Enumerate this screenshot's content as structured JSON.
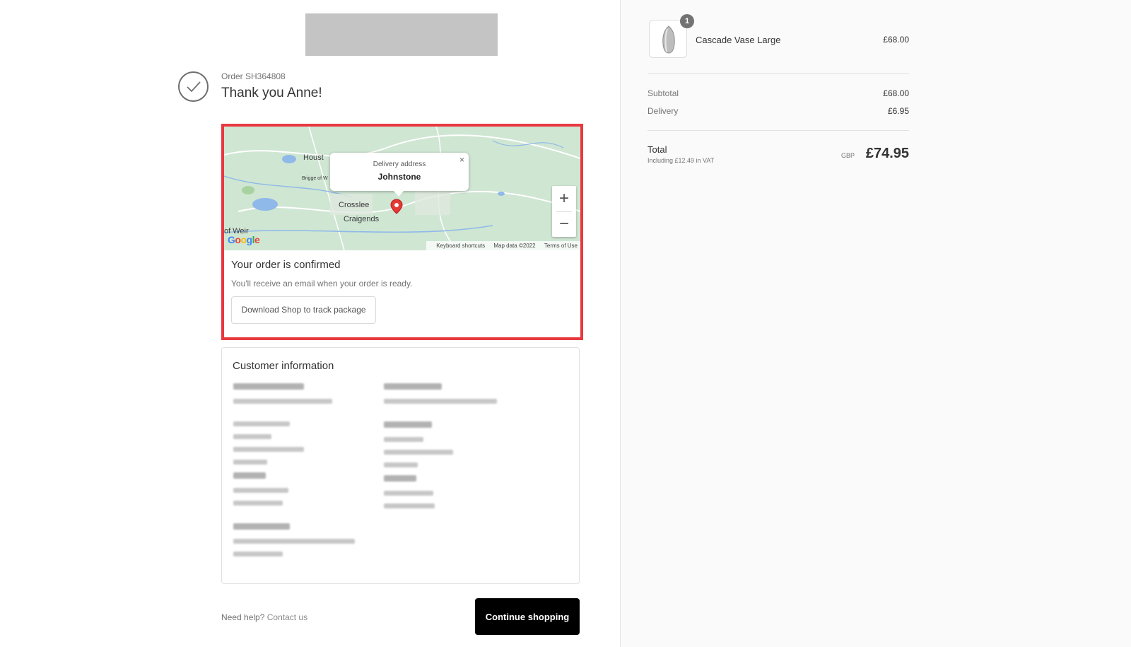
{
  "header": {
    "logo": "store-logo-placeholder"
  },
  "order": {
    "number": "Order SH364808",
    "thank_you": "Thank you Anne!"
  },
  "map": {
    "labels": {
      "houston": "Houst",
      "bridge": "Brigge of W",
      "crosslee": "Crosslee",
      "craigends": "Craigends",
      "weir": "of Weir"
    },
    "popup_title": "Delivery address",
    "popup_city": "Johnstone",
    "popup_close": "×",
    "zoom_in": "+",
    "zoom_out": "−",
    "google": "Google",
    "footer": {
      "shortcuts": "Keyboard shortcuts",
      "map_data": "Map data ©2022",
      "terms": "Terms of Use"
    }
  },
  "confirmation": {
    "title": "Your order is confirmed",
    "text": "You'll receive an email when your order is ready.",
    "download_button": "Download Shop to track package"
  },
  "customer": {
    "title": "Customer information"
  },
  "footer": {
    "need_help": "Need help?",
    "contact": "Contact us",
    "continue_button": "Continue shopping"
  },
  "summary": {
    "product": {
      "name": "Cascade Vase Large",
      "price": "£68.00",
      "quantity": "1",
      "icon": "vase-icon"
    },
    "subtotal_label": "Subtotal",
    "subtotal_value": "£68.00",
    "delivery_label": "Delivery",
    "delivery_value": "£6.95",
    "total_label": "Total",
    "vat_note": "Including £12.49 in VAT",
    "currency": "GBP",
    "total_value": "£74.95"
  },
  "colors": {
    "highlight_border": "#e8393f",
    "map_green": "#c9e3cf",
    "water_blue": "#8fb9e8",
    "pin_red": "#e53935",
    "button_black": "#000000"
  }
}
